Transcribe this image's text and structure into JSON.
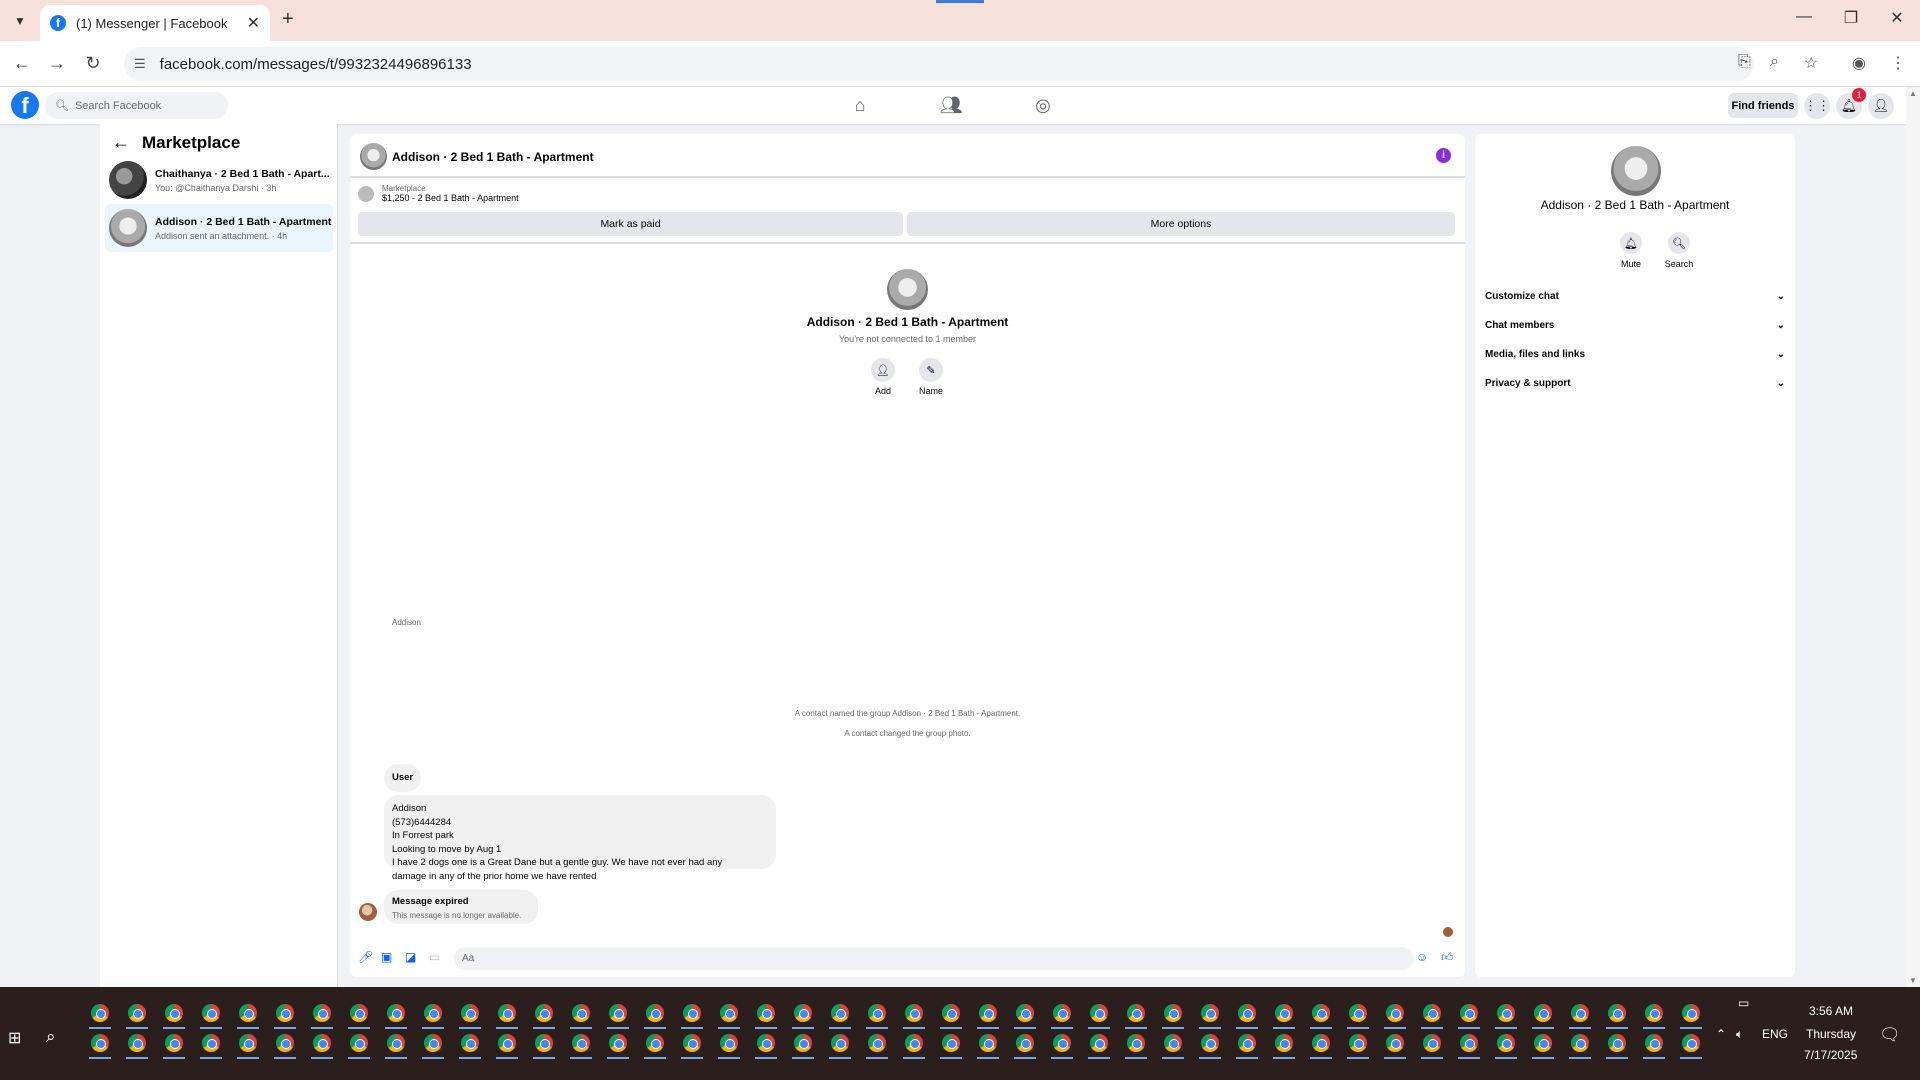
{
  "browser": {
    "tab_title": "(1) Messenger | Facebook",
    "url": "facebook.com/messages/t/9932324496896133"
  },
  "fb_header": {
    "search_placeholder": "Search Facebook",
    "find_friends": "Find friends",
    "notification_count": "1"
  },
  "sidebar": {
    "title": "Marketplace",
    "conversations": [
      {
        "title": "Chaithanya · 2 Bed 1 Bath - Apart...",
        "subtitle": "You: @Chaithanya Darshi · 3h"
      },
      {
        "title": "Addison · 2 Bed 1 Bath - Apartment",
        "subtitle": "Addison sent an attachment. · 4h"
      }
    ]
  },
  "chat": {
    "header_name": "Addison · 2 Bed 1 Bath - Apartment",
    "listing_category": "Marketplace",
    "listing_price": "$1,250 - 2 Bed 1 Bath - Apartment",
    "mark_paid": "Mark as paid",
    "more_options": "More options",
    "group_name": "Addison · 2 Bed 1 Bath - Apartment",
    "group_sub": "You're not connected to 1 member",
    "add_label": "Add",
    "name_label": "Name",
    "system_1": "A contact named the group Addison · 2 Bed 1 Bath - Apartment.",
    "system_2": "A contact changed the group photo.",
    "sender": "Addison",
    "msg_user": "User",
    "msg_lines": [
      "Addison",
      "(573)6444284",
      "In Forrest park",
      "Looking to move by Aug 1",
      "I have 2 dogs one is a Great Dane but a gentle guy. We have not ever had any",
      "damage in any of the prior home we have rented"
    ],
    "expired_title": "Message expired",
    "expired_sub": "This message is no longer available.",
    "composer_placeholder": "Aa"
  },
  "right_panel": {
    "name": "Addison · 2 Bed 1 Bath - Apartment",
    "mute": "Mute",
    "search": "Search",
    "sections": [
      "Customize chat",
      "Chat members",
      "Media, files and links",
      "Privacy & support"
    ]
  },
  "taskbar": {
    "time": "3:56 AM",
    "day": "Thursday",
    "date": "7/17/2025",
    "lang": "ENG"
  },
  "colors": {
    "brand": "#1877f2",
    "messenger_blue": "#0866ff",
    "badge_red": "#e41e3f",
    "info_purple": "#8a2be2"
  }
}
